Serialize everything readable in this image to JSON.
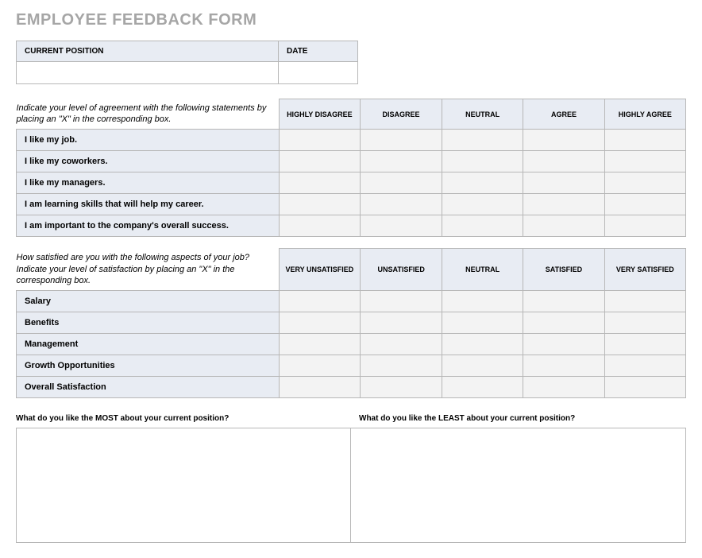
{
  "title": "EMPLOYEE FEEDBACK FORM",
  "info": {
    "position_label": "CURRENT POSITION",
    "date_label": "DATE",
    "position_value": "",
    "date_value": ""
  },
  "section1": {
    "instructions": "Indicate your level of agreement with the following statements by placing an \"X\" in the corresponding box.",
    "columns": [
      "HIGHLY DISAGREE",
      "DISAGREE",
      "NEUTRAL",
      "AGREE",
      "HIGHLY AGREE"
    ],
    "rows": [
      "I like my job.",
      "I like my coworkers.",
      "I like my managers.",
      "I am learning skills that will help my career.",
      "I am important to the company's overall success."
    ]
  },
  "section2": {
    "instructions": "How satisfied are you with the following aspects of your job?  Indicate your level of satisfaction by placing an \"X\" in the corresponding box.",
    "columns": [
      "VERY UNSATISFIED",
      "UNSATISFIED",
      "NEUTRAL",
      "SATISFIED",
      "VERY SATISFIED"
    ],
    "rows": [
      "Salary",
      "Benefits",
      "Management",
      "Growth Opportunities",
      "Overall Satisfaction"
    ]
  },
  "freetext": {
    "most_label": "What do you like the MOST about your current position?",
    "least_label": "What do you like the LEAST about your current position?",
    "most_value": "",
    "least_value": ""
  }
}
